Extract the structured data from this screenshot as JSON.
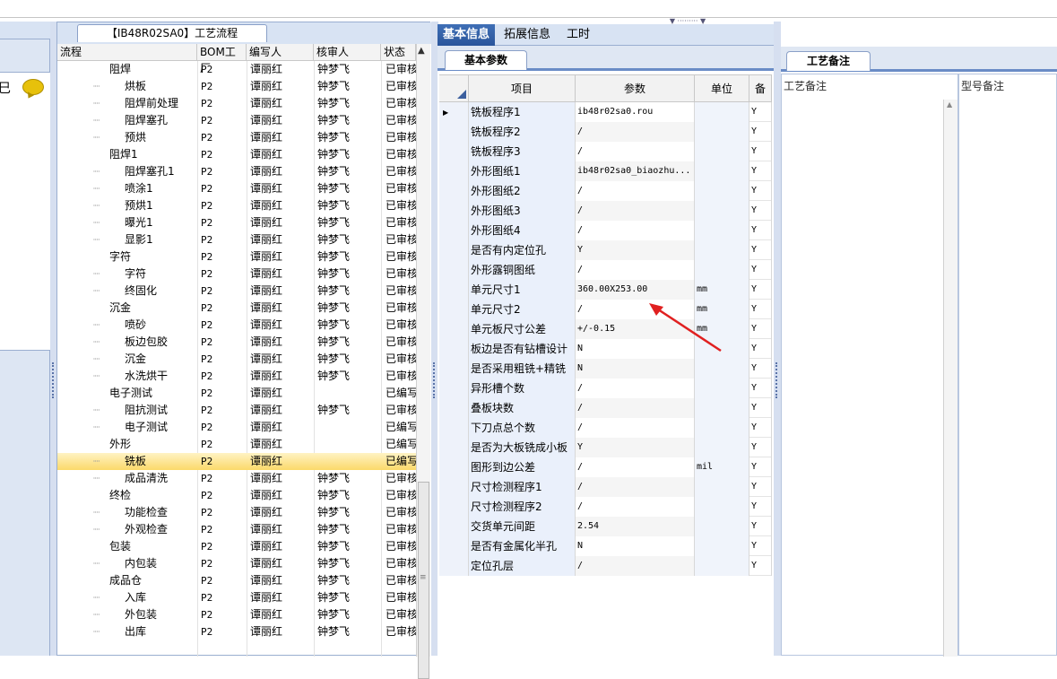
{
  "tree_panel": {
    "tab_title": "【IB48R02SA0】工艺流程",
    "columns": [
      "流程",
      "BOM工厂",
      "编写人",
      "核审人",
      "状态"
    ],
    "rows": [
      {
        "level": 0,
        "name": "阻焊",
        "bom": "P2",
        "writer": "谭丽红",
        "reviewer": "钟梦飞",
        "status": "已审核"
      },
      {
        "level": 1,
        "name": "烘板",
        "bom": "P2",
        "writer": "谭丽红",
        "reviewer": "钟梦飞",
        "status": "已审核"
      },
      {
        "level": 1,
        "name": "阻焊前处理",
        "bom": "P2",
        "writer": "谭丽红",
        "reviewer": "钟梦飞",
        "status": "已审核"
      },
      {
        "level": 1,
        "name": "阻焊塞孔",
        "bom": "P2",
        "writer": "谭丽红",
        "reviewer": "钟梦飞",
        "status": "已审核"
      },
      {
        "level": 1,
        "name": "预烘",
        "bom": "P2",
        "writer": "谭丽红",
        "reviewer": "钟梦飞",
        "status": "已审核"
      },
      {
        "level": 0,
        "name": "阻焊1",
        "bom": "P2",
        "writer": "谭丽红",
        "reviewer": "钟梦飞",
        "status": "已审核"
      },
      {
        "level": 1,
        "name": "阻焊塞孔1",
        "bom": "P2",
        "writer": "谭丽红",
        "reviewer": "钟梦飞",
        "status": "已审核"
      },
      {
        "level": 1,
        "name": "喷涂1",
        "bom": "P2",
        "writer": "谭丽红",
        "reviewer": "钟梦飞",
        "status": "已审核"
      },
      {
        "level": 1,
        "name": "预烘1",
        "bom": "P2",
        "writer": "谭丽红",
        "reviewer": "钟梦飞",
        "status": "已审核"
      },
      {
        "level": 1,
        "name": "曝光1",
        "bom": "P2",
        "writer": "谭丽红",
        "reviewer": "钟梦飞",
        "status": "已审核"
      },
      {
        "level": 1,
        "name": "显影1",
        "bom": "P2",
        "writer": "谭丽红",
        "reviewer": "钟梦飞",
        "status": "已审核"
      },
      {
        "level": 0,
        "name": "字符",
        "bom": "P2",
        "writer": "谭丽红",
        "reviewer": "钟梦飞",
        "status": "已审核"
      },
      {
        "level": 1,
        "name": "字符",
        "bom": "P2",
        "writer": "谭丽红",
        "reviewer": "钟梦飞",
        "status": "已审核"
      },
      {
        "level": 1,
        "name": "终固化",
        "bom": "P2",
        "writer": "谭丽红",
        "reviewer": "钟梦飞",
        "status": "已审核"
      },
      {
        "level": 0,
        "name": "沉金",
        "bom": "P2",
        "writer": "谭丽红",
        "reviewer": "钟梦飞",
        "status": "已审核"
      },
      {
        "level": 1,
        "name": "喷砂",
        "bom": "P2",
        "writer": "谭丽红",
        "reviewer": "钟梦飞",
        "status": "已审核"
      },
      {
        "level": 1,
        "name": "板边包胶",
        "bom": "P2",
        "writer": "谭丽红",
        "reviewer": "钟梦飞",
        "status": "已审核"
      },
      {
        "level": 1,
        "name": "沉金",
        "bom": "P2",
        "writer": "谭丽红",
        "reviewer": "钟梦飞",
        "status": "已审核"
      },
      {
        "level": 1,
        "name": "水洗烘干",
        "bom": "P2",
        "writer": "谭丽红",
        "reviewer": "钟梦飞",
        "status": "已审核"
      },
      {
        "level": 0,
        "name": "电子测试",
        "bom": "P2",
        "writer": "谭丽红",
        "reviewer": "",
        "status": "已编写"
      },
      {
        "level": 1,
        "name": "阻抗测试",
        "bom": "P2",
        "writer": "谭丽红",
        "reviewer": "钟梦飞",
        "status": "已审核"
      },
      {
        "level": 1,
        "name": "电子测试",
        "bom": "P2",
        "writer": "谭丽红",
        "reviewer": "",
        "status": "已编写"
      },
      {
        "level": 0,
        "name": "外形",
        "bom": "P2",
        "writer": "谭丽红",
        "reviewer": "",
        "status": "已编写"
      },
      {
        "level": 1,
        "name": "铣板",
        "bom": "P2",
        "writer": "谭丽红",
        "reviewer": "",
        "status": "已编写",
        "selected": true
      },
      {
        "level": 1,
        "name": "成品清洗",
        "bom": "P2",
        "writer": "谭丽红",
        "reviewer": "钟梦飞",
        "status": "已审核"
      },
      {
        "level": 0,
        "name": "终检",
        "bom": "P2",
        "writer": "谭丽红",
        "reviewer": "钟梦飞",
        "status": "已审核"
      },
      {
        "level": 1,
        "name": "功能检查",
        "bom": "P2",
        "writer": "谭丽红",
        "reviewer": "钟梦飞",
        "status": "已审核"
      },
      {
        "level": 1,
        "name": "外观检查",
        "bom": "P2",
        "writer": "谭丽红",
        "reviewer": "钟梦飞",
        "status": "已审核"
      },
      {
        "level": 0,
        "name": "包装",
        "bom": "P2",
        "writer": "谭丽红",
        "reviewer": "钟梦飞",
        "status": "已审核"
      },
      {
        "level": 1,
        "name": "内包装",
        "bom": "P2",
        "writer": "谭丽红",
        "reviewer": "钟梦飞",
        "status": "已审核"
      },
      {
        "level": 0,
        "name": "成品仓",
        "bom": "P2",
        "writer": "谭丽红",
        "reviewer": "钟梦飞",
        "status": "已审核"
      },
      {
        "level": 1,
        "name": "入库",
        "bom": "P2",
        "writer": "谭丽红",
        "reviewer": "钟梦飞",
        "status": "已审核"
      },
      {
        "level": 1,
        "name": "外包装",
        "bom": "P2",
        "writer": "谭丽红",
        "reviewer": "钟梦飞",
        "status": "已审核"
      },
      {
        "level": 1,
        "name": "出库",
        "bom": "P2",
        "writer": "谭丽红",
        "reviewer": "钟梦飞",
        "status": "已审核"
      }
    ]
  },
  "left_strip": {
    "label": "巳"
  },
  "top_tabs": [
    "基本信息",
    "拓展信息",
    "工时"
  ],
  "sub_tab": "基本参数",
  "grid": {
    "columns": [
      "项目",
      "参数",
      "单位",
      "备"
    ],
    "rows": [
      {
        "item": "铣板程序1",
        "param": "ib48r02sa0.rou",
        "unit": "",
        "flag": "Y",
        "current": true
      },
      {
        "item": "铣板程序2",
        "param": "/",
        "unit": "",
        "flag": "Y"
      },
      {
        "item": "铣板程序3",
        "param": "/",
        "unit": "",
        "flag": "Y"
      },
      {
        "item": "外形图纸1",
        "param": "ib48r02sa0_biaozhu...",
        "unit": "",
        "flag": "Y"
      },
      {
        "item": "外形图纸2",
        "param": "/",
        "unit": "",
        "flag": "Y"
      },
      {
        "item": "外形图纸3",
        "param": "/",
        "unit": "",
        "flag": "Y"
      },
      {
        "item": "外形图纸4",
        "param": "/",
        "unit": "",
        "flag": "Y"
      },
      {
        "item": "是否有内定位孔",
        "param": "Y",
        "unit": "",
        "flag": "Y"
      },
      {
        "item": "外形露铜图纸",
        "param": "/",
        "unit": "",
        "flag": "Y"
      },
      {
        "item": "单元尺寸1",
        "param": "360.00X253.00",
        "unit": "mm",
        "flag": "Y"
      },
      {
        "item": "单元尺寸2",
        "param": "/",
        "unit": "mm",
        "flag": "Y"
      },
      {
        "item": "单元板尺寸公差",
        "param": "+/-0.15",
        "unit": "mm",
        "flag": "Y"
      },
      {
        "item": "板边是否有钻槽设计",
        "param": "N",
        "unit": "",
        "flag": "Y"
      },
      {
        "item": "是否采用粗铣+精铣",
        "param": "N",
        "unit": "",
        "flag": "Y"
      },
      {
        "item": "异形槽个数",
        "param": "/",
        "unit": "",
        "flag": "Y"
      },
      {
        "item": "叠板块数",
        "param": "/",
        "unit": "",
        "flag": "Y"
      },
      {
        "item": "下刀点总个数",
        "param": "/",
        "unit": "",
        "flag": "Y"
      },
      {
        "item": "是否为大板铣成小板",
        "param": "Y",
        "unit": "",
        "flag": "Y"
      },
      {
        "item": "图形到边公差",
        "param": "/",
        "unit": "mil",
        "flag": "Y"
      },
      {
        "item": "尺寸检测程序1",
        "param": "/",
        "unit": "",
        "flag": "Y"
      },
      {
        "item": "尺寸检测程序2",
        "param": "/",
        "unit": "",
        "flag": "Y"
      },
      {
        "item": "交货单元间距",
        "param": "2.54",
        "unit": "",
        "flag": "Y"
      },
      {
        "item": "是否有金属化半孔",
        "param": "N",
        "unit": "",
        "flag": "Y"
      },
      {
        "item": "定位孔层",
        "param": "/",
        "unit": "",
        "flag": "Y"
      }
    ]
  },
  "right_panel": {
    "tab": "工艺备注",
    "left_label": "工艺备注",
    "right_label": "型号备注"
  },
  "colors": {
    "accent": "#2a559b",
    "arrow": "#e02020",
    "folder": "#f3c64a",
    "selected": "#fbd96a"
  }
}
